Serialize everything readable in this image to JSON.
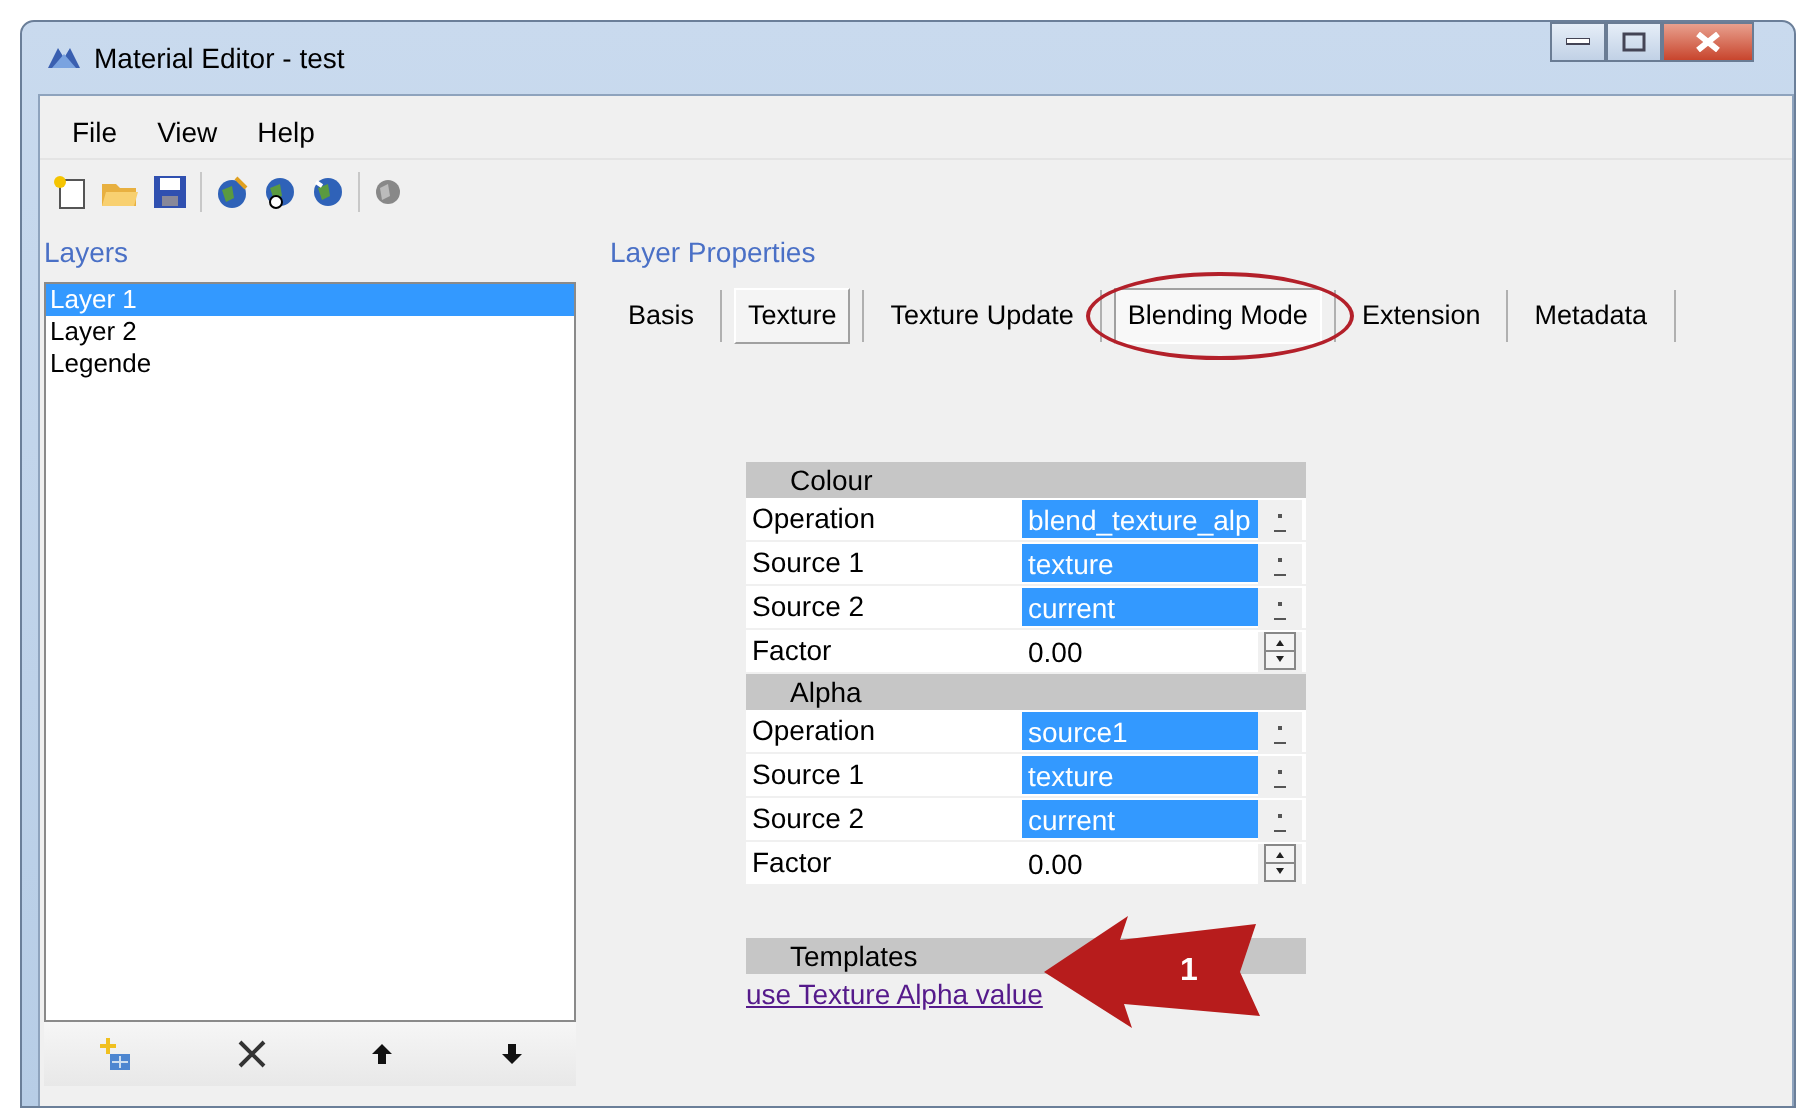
{
  "window": {
    "title": "Material Editor - test"
  },
  "menu": [
    "File",
    "View",
    "Help"
  ],
  "layers": {
    "title": "Layers",
    "items": [
      {
        "label": "Layer 1",
        "selected": true
      },
      {
        "label": "Layer 2",
        "selected": false
      },
      {
        "label": "Legende",
        "selected": false
      }
    ]
  },
  "properties": {
    "title": "Layer Properties",
    "tabs": [
      {
        "label": "Basis",
        "selected": false,
        "raised": false
      },
      {
        "label": "Texture",
        "selected": false,
        "raised": true
      },
      {
        "label": "Texture Update",
        "selected": false,
        "raised": false
      },
      {
        "label": "Blending Mode",
        "selected": true,
        "raised": false,
        "circled": true
      },
      {
        "label": "Extension",
        "selected": false,
        "raised": false
      },
      {
        "label": "Metadata",
        "selected": false,
        "raised": false
      }
    ],
    "groups": [
      {
        "title": "Colour",
        "rows": [
          {
            "label": "Operation",
            "value": "blend_texture_alp",
            "kind": "choice"
          },
          {
            "label": "Source 1",
            "value": "texture",
            "kind": "choice"
          },
          {
            "label": "Source 2",
            "value": "current",
            "kind": "choice"
          },
          {
            "label": "Factor",
            "value": "0.00",
            "kind": "number"
          }
        ]
      },
      {
        "title": "Alpha",
        "rows": [
          {
            "label": "Operation",
            "value": "source1",
            "kind": "choice"
          },
          {
            "label": "Source 1",
            "value": "texture",
            "kind": "choice"
          },
          {
            "label": "Source 2",
            "value": "current",
            "kind": "choice"
          },
          {
            "label": "Factor",
            "value": "0.00",
            "kind": "number"
          }
        ]
      }
    ],
    "templates": {
      "title": "Templates",
      "link": "use Texture Alpha value"
    }
  },
  "callout": {
    "label": "1"
  }
}
